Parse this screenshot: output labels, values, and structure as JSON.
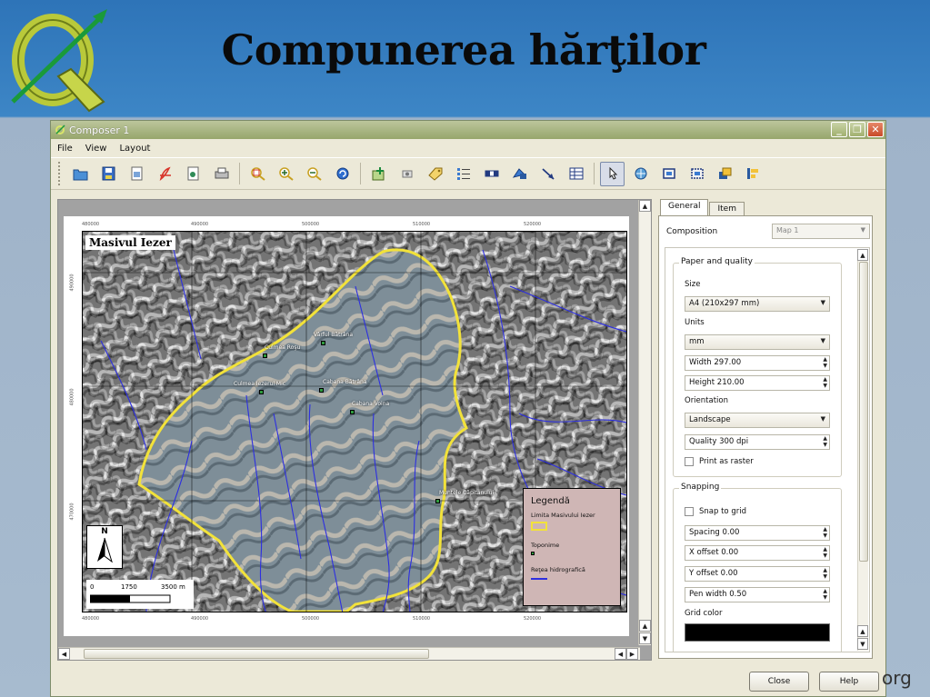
{
  "slide": {
    "title": "Compunerea hărţilor",
    "footer_fragment": "org"
  },
  "window": {
    "title": "Composer 1",
    "buttons": [
      "_",
      "❐",
      "✕"
    ]
  },
  "menu": [
    "File",
    "View",
    "Layout"
  ],
  "toolbar": {
    "icons": [
      "open-icon",
      "save-icon",
      "export-image-icon",
      "export-pdf-icon",
      "export-svg-icon",
      "print-icon",
      "zoom-full-icon",
      "zoom-in-icon",
      "zoom-out-icon",
      "refresh-icon",
      "add-map-icon",
      "add-image-icon",
      "add-label-icon",
      "add-legend-icon",
      "add-scalebar-icon",
      "add-shape-icon",
      "add-arrow-icon",
      "add-table-icon",
      "select-move-icon",
      "move-content-icon",
      "group-icon",
      "ungroup-icon",
      "raise-icon",
      "align-icon"
    ]
  },
  "map": {
    "label": "Masivul Iezer",
    "coords_top": [
      "480000",
      "490000",
      "500000",
      "510000",
      "520000"
    ],
    "coords_side": [
      "490000",
      "480000",
      "470000"
    ],
    "toponyms": [
      "Vârful Bătrâna",
      "Culmea Roşu",
      "Culmea Iezerul Mic",
      "Cabana Bătrâna",
      "Cabana Voina",
      "Muntele Căpitanului"
    ],
    "north_label": "N",
    "scale": {
      "l0": "0",
      "l1": "1750",
      "l2": "3500 m"
    }
  },
  "legend": {
    "title": "Legendă",
    "items": [
      "Limita Masivului Iezer",
      "Toponime",
      "Reţea hidrografică"
    ],
    "colors": {
      "limit": "#f2e23a",
      "toponyms": "#2f9a3e",
      "rivers": "#2d2fe0"
    }
  },
  "panel": {
    "tabs": [
      "General",
      "Item"
    ],
    "composition_label": "Composition",
    "composition_value": "Map 1",
    "paper_group": "Paper and quality",
    "size_label": "Size",
    "size_value": "A4 (210x297 mm)",
    "units_label": "Units",
    "units_value": "mm",
    "width_value": "Width 297.00",
    "height_value": "Height 210.00",
    "orientation_label": "Orientation",
    "orientation_value": "Landscape",
    "quality_value": "Quality 300 dpi",
    "print_raster": "Print as raster",
    "snapping_group": "Snapping",
    "snap_grid": "Snap to grid",
    "spacing": "Spacing 0.00",
    "x_offset": "X offset 0.00",
    "y_offset": "Y offset 0.00",
    "pen_width": "Pen width 0.50",
    "grid_color_label": "Grid color"
  },
  "buttons": {
    "close": "Close",
    "help": "Help"
  }
}
